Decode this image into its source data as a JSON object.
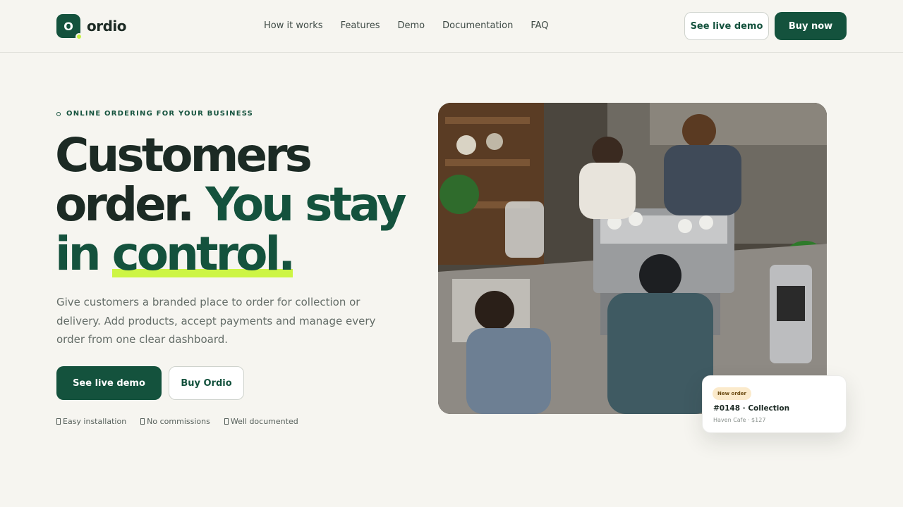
{
  "brand": {
    "logo_letter": "O",
    "name": "ordio",
    "primary_color": "#14523d",
    "accent_color": "#cdf544"
  },
  "nav": {
    "items": [
      {
        "label": "How it works"
      },
      {
        "label": "Features"
      },
      {
        "label": "Demo"
      },
      {
        "label": "Documentation"
      },
      {
        "label": "FAQ"
      }
    ]
  },
  "header_actions": {
    "demo_label": "See live demo",
    "buy_label": "Buy now"
  },
  "hero": {
    "eyebrow": "ONLINE ORDERING FOR YOUR BUSINESS",
    "headline_part1": "Customers order.",
    "headline_part2": "You stay in",
    "headline_highlight": "control.",
    "description": "Give customers a branded place to order for collection or delivery. Add products, accept payments and manage every order from one clear dashboard.",
    "primary_cta": "See live demo",
    "secondary_cta": "Buy Ordio",
    "perks": [
      {
        "icon": "check-icon",
        "label": "Easy installation"
      },
      {
        "icon": "check-icon",
        "label": "No commissions"
      },
      {
        "icon": "check-icon",
        "label": "Well documented"
      }
    ]
  },
  "order_card": {
    "badge": "New order",
    "title": "#0148 · Collection",
    "subtitle": "Haven Cafe · $127"
  }
}
